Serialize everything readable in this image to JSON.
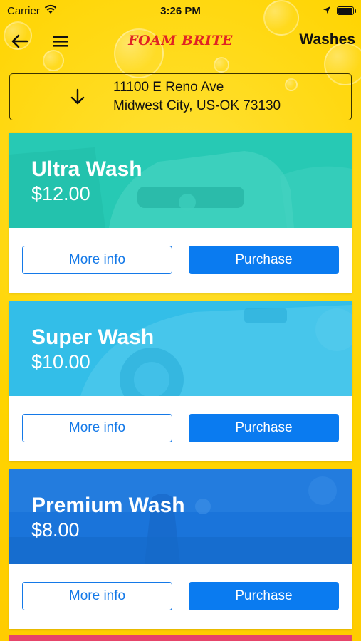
{
  "status_bar": {
    "carrier": "Carrier",
    "time": "3:26 PM"
  },
  "nav": {
    "logo": "FOAM BRITE",
    "title": "Washes"
  },
  "location": {
    "line1": "11100 E Reno Ave",
    "line2": "Midwest City, US-OK  73130"
  },
  "washes": [
    {
      "name": "Ultra Wash",
      "price": "$12.00",
      "color": "#27C9B4",
      "more_info_label": "More info",
      "purchase_label": "Purchase"
    },
    {
      "name": "Super Wash",
      "price": "$10.00",
      "color": "#33BEE8",
      "more_info_label": "More info",
      "purchase_label": "Purchase"
    },
    {
      "name": "Premium Wash",
      "price": "$8.00",
      "color": "#1A74DA",
      "more_info_label": "More info",
      "purchase_label": "Purchase"
    }
  ],
  "next_card_color": "#E6446A",
  "colors": {
    "background": "#FFD400",
    "accent_blue": "#0A7BF0",
    "logo_red": "#E02424"
  }
}
